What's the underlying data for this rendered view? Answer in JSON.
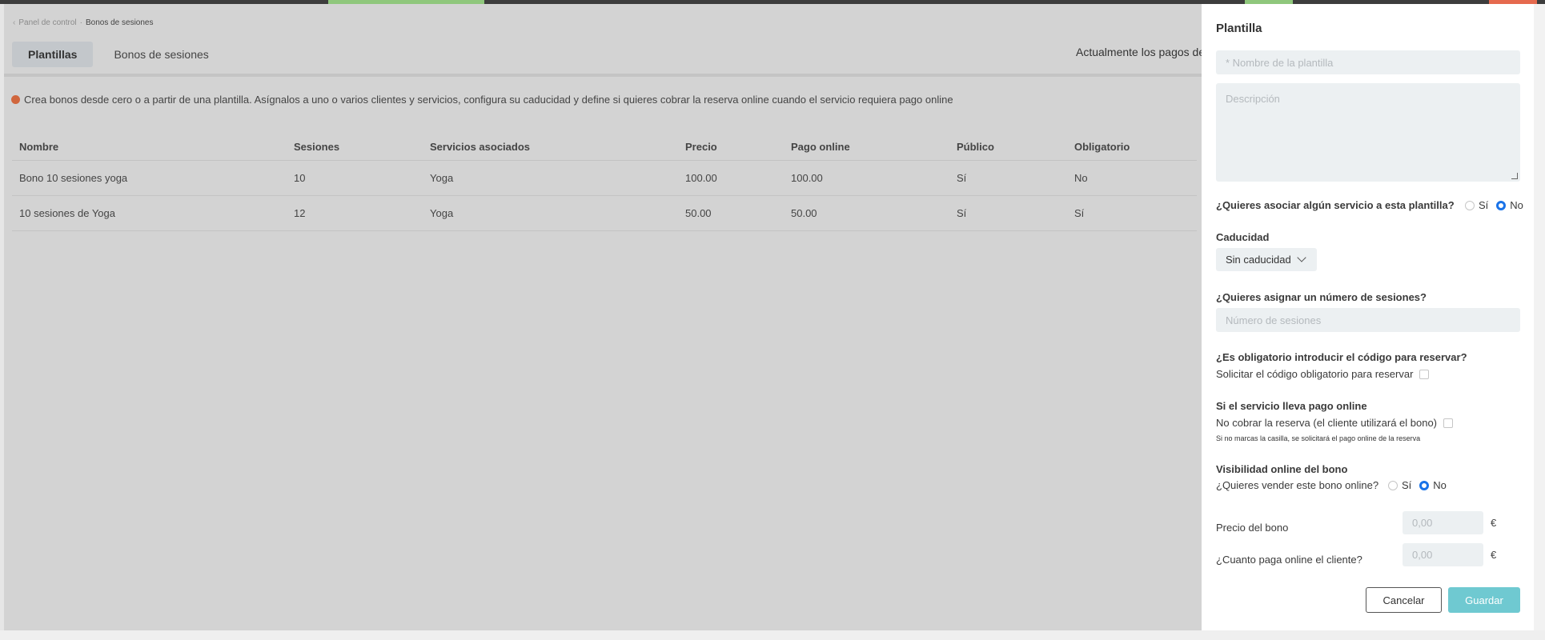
{
  "breadcrumb": {
    "parent": "Panel de control",
    "current": "Bonos de sesiones"
  },
  "tabs": [
    {
      "label": "Plantillas",
      "active": true
    },
    {
      "label": "Bonos de sesiones",
      "active": false
    }
  ],
  "notice": "Actualmente los pagos de",
  "info_text": "Crea bonos desde cero o a partir de una plantilla. Asígnalos a uno o varios clientes y servicios, configura su caducidad y define si quieres cobrar la reserva online cuando el servicio requiera pago online",
  "table": {
    "headers": [
      "Nombre",
      "Sesiones",
      "Servicios asociados",
      "Precio",
      "Pago online",
      "Público",
      "Obligatorio"
    ],
    "rows": [
      [
        "Bono 10 sesiones yoga",
        "10",
        "Yoga",
        "100.00",
        "100.00",
        "Sí",
        "No"
      ],
      [
        "10 sesiones de Yoga",
        "12",
        "Yoga",
        "50.00",
        "50.00",
        "Sí",
        "Sí"
      ]
    ]
  },
  "panel": {
    "title": "Plantilla",
    "name_placeholder": "* Nombre de la plantilla",
    "description_placeholder": "Descripción",
    "associate_service_question": "¿Quieres asociar algún servicio a esta plantilla?",
    "yes_label": "Sí",
    "no_label": "No",
    "expiry_label": "Caducidad",
    "expiry_value": "Sin caducidad",
    "sessions_question": "¿Quieres asignar un número de sesiones?",
    "sessions_placeholder": "Número de sesiones",
    "mandatory_question": "¿Es obligatorio introducir el código para reservar?",
    "mandatory_checkbox_label": "Solicitar el código obligatorio para reservar",
    "online_payment_heading": "Si el servicio lleva pago online",
    "online_payment_checkbox_label": "No cobrar la reserva (el cliente utilizará el bono)",
    "online_payment_hint": "Si no marcas la casilla, se solicitará el pago online de la reserva",
    "visibility_heading": "Visibilidad online del bono",
    "visibility_question": "¿Quieres vender este bono online?",
    "price_label": "Precio del bono",
    "price_placeholder": "0,00",
    "online_pay_label": "¿Cuanto paga online el cliente?",
    "online_pay_placeholder": "0,00",
    "currency": "€",
    "cancel_label": "Cancelar",
    "save_label": "Guardar"
  },
  "colors": {
    "accent": "#1a73e8",
    "save_button": "#6fc9d1",
    "info_dot": "#d0663d"
  }
}
